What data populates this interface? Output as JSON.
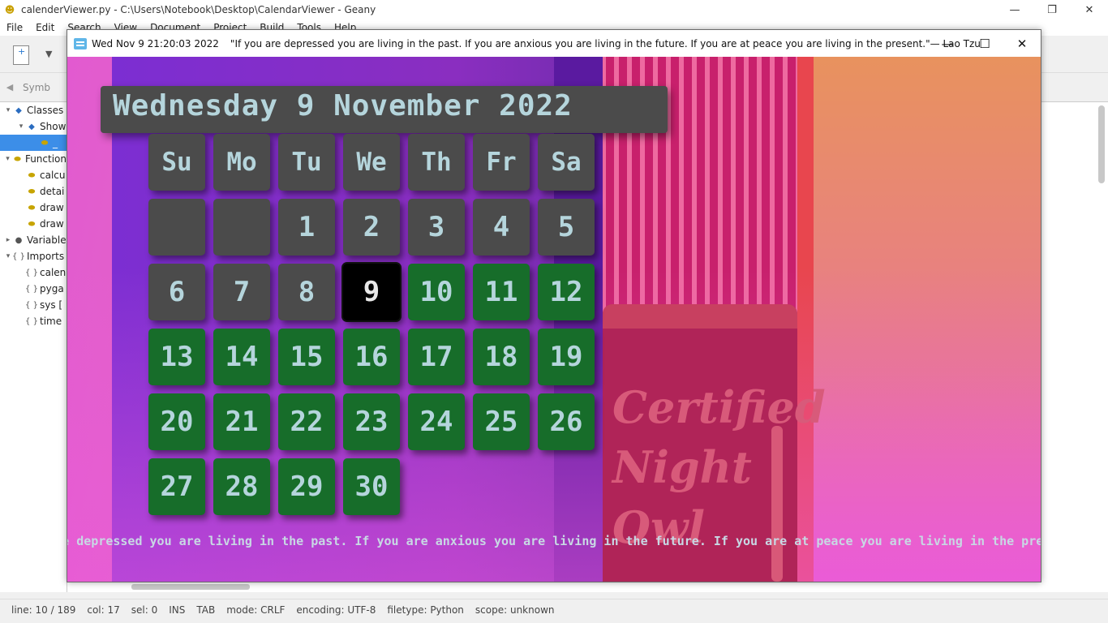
{
  "geany": {
    "window_title": "calenderViewer.py - C:\\Users\\Notebook\\Desktop\\CalendarViewer - Geany",
    "menu": [
      "File",
      "Edit",
      "Search",
      "View",
      "Document",
      "Project",
      "Build",
      "Tools",
      "Help"
    ],
    "sidebar_tab": "Symb",
    "tree": [
      {
        "label": "Classes",
        "icon": "class-icon",
        "level": 0,
        "expander": "▾"
      },
      {
        "label": "Show",
        "icon": "class-icon",
        "level": 1,
        "expander": "▾"
      },
      {
        "label": "_",
        "icon": "function-icon",
        "level": 2,
        "expander": "",
        "selected": true
      },
      {
        "label": "Function",
        "icon": "function-icon",
        "level": 0,
        "expander": "▾"
      },
      {
        "label": "calcu",
        "icon": "function-icon",
        "level": 1,
        "expander": ""
      },
      {
        "label": "detai",
        "icon": "function-icon",
        "level": 1,
        "expander": ""
      },
      {
        "label": "draw",
        "icon": "function-icon",
        "level": 1,
        "expander": ""
      },
      {
        "label": "draw",
        "icon": "function-icon",
        "level": 1,
        "expander": ""
      },
      {
        "label": "Variable",
        "icon": "variable-icon",
        "level": 0,
        "expander": "▸"
      },
      {
        "label": "Imports",
        "icon": "import-icon",
        "level": 0,
        "expander": "▾"
      },
      {
        "label": "calen",
        "icon": "import-icon",
        "level": 1,
        "expander": ""
      },
      {
        "label": "pyga",
        "icon": "import-icon",
        "level": 1,
        "expander": ""
      },
      {
        "label": "sys [",
        "icon": "import-icon",
        "level": 1,
        "expander": ""
      },
      {
        "label": "time",
        "icon": "import-icon",
        "level": 1,
        "expander": ""
      }
    ],
    "status": {
      "line": "line: 10 / 189",
      "col": "col: 17",
      "sel": "sel: 0",
      "ins": "INS",
      "tab": "TAB",
      "mode": "mode: CRLF",
      "encoding": "encoding: UTF-8",
      "filetype": "filetype: Python",
      "scope": "scope: unknown"
    }
  },
  "calendar_window": {
    "title_date": "Wed Nov  9 21:20:03 2022",
    "title_quote": "\"If you are depressed you are living in the past. If you are anxious you are living in the future. If you are at peace you are living in the present.\"— Lao Tzu",
    "header": "Wednesday 9 November 2022",
    "weekdays": [
      "Su",
      "Mo",
      "Tu",
      "We",
      "Th",
      "Fr",
      "Sa"
    ],
    "leading_blanks": 2,
    "days_in_month": 30,
    "today": 9,
    "book_text": [
      "Certified",
      "Night",
      "Owl"
    ],
    "marquee": "ou are depressed you are living in the past. If you are anxious you are living in the future. If you are at peace you are living in the prese",
    "colors": {
      "cell_past": "#4b4b4b",
      "cell_today": "#000000",
      "cell_future": "#176d2a",
      "cell_text": "#b5d5dc"
    }
  }
}
